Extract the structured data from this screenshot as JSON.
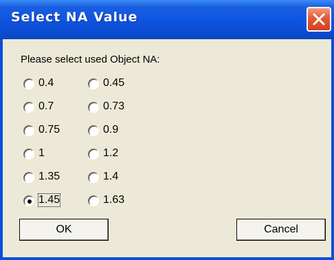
{
  "window": {
    "title": "Select NA Value"
  },
  "prompt": "Please select used Object NA:",
  "options": [
    {
      "label": "0.4",
      "selected": false
    },
    {
      "label": "0.45",
      "selected": false
    },
    {
      "label": "0.7",
      "selected": false
    },
    {
      "label": "0.73",
      "selected": false
    },
    {
      "label": "0.75",
      "selected": false
    },
    {
      "label": "0.9",
      "selected": false
    },
    {
      "label": "1",
      "selected": false
    },
    {
      "label": "1.2",
      "selected": false
    },
    {
      "label": "1.35",
      "selected": false
    },
    {
      "label": "1.4",
      "selected": false
    },
    {
      "label": "1.45",
      "selected": true
    },
    {
      "label": "1.63",
      "selected": false
    }
  ],
  "buttons": {
    "ok": "OK",
    "cancel": "Cancel"
  },
  "icons": {
    "close": "close-icon"
  },
  "colors": {
    "titlebar": "#0b4fd8",
    "close_button": "#e2593a",
    "dialog_background": "#ece9d8"
  }
}
